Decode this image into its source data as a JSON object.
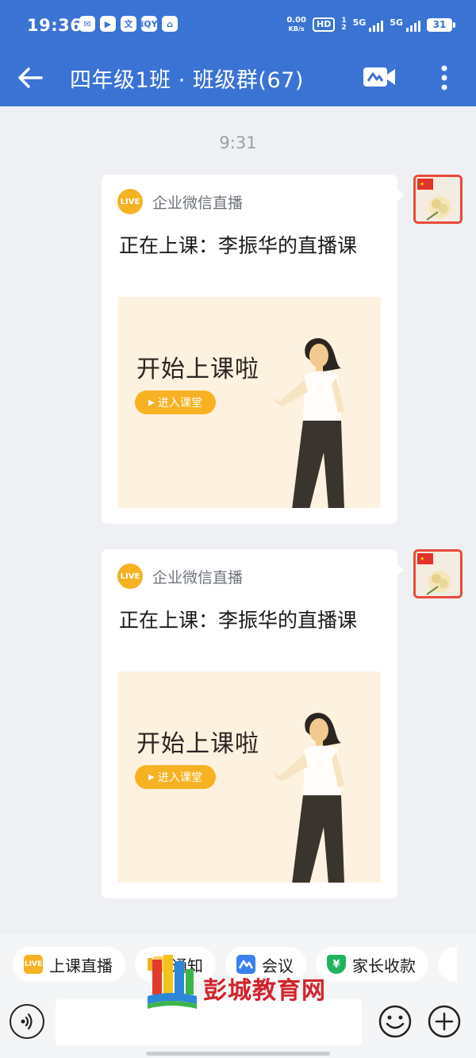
{
  "status_bar": {
    "time": "19:36",
    "apps": [
      "✉",
      "▶",
      "文",
      "iQY",
      "⌂"
    ],
    "net_speed_value": "0.00",
    "net_speed_unit": "KB/s",
    "hd": "HD",
    "sim1": "1",
    "sim2": "2",
    "signal_1": "5G",
    "signal_2": "5G",
    "battery": "31"
  },
  "header": {
    "title": "四年级1班 · 班级群(67)",
    "back_icon": "arrow-left-icon",
    "video_icon": "video-meeting-icon",
    "more_icon": "more-vertical-icon"
  },
  "chat": {
    "timestamp": "9:31",
    "messages": [
      {
        "live_badge": "LIVE",
        "source": "企业微信直播",
        "title": "正在上课：李振华的直播课",
        "banner_title": "开始上课啦",
        "enter_label": "进入课堂"
      },
      {
        "live_badge": "LIVE",
        "source": "企业微信直播",
        "title": "正在上课：李振华的直播课",
        "banner_title": "开始上课啦",
        "enter_label": "进入课堂"
      }
    ]
  },
  "quick_actions": [
    {
      "label": "上课直播",
      "icon": "LIVE",
      "color": "#f6b223"
    },
    {
      "label": "通知",
      "icon": "",
      "color": "#f6b223"
    },
    {
      "label": "会议",
      "icon": "",
      "color": "#3b7ff0"
    },
    {
      "label": "家长收款",
      "icon": "¥",
      "color": "#22b35f"
    }
  ],
  "composer": {
    "placeholder": ""
  },
  "watermark": {
    "text": "彭城教育网"
  },
  "colors": {
    "header_blue": "#3b73d5",
    "live_orange": "#f6b223",
    "banner_bg": "#fdf1df",
    "chat_bg": "#eef0f3"
  }
}
